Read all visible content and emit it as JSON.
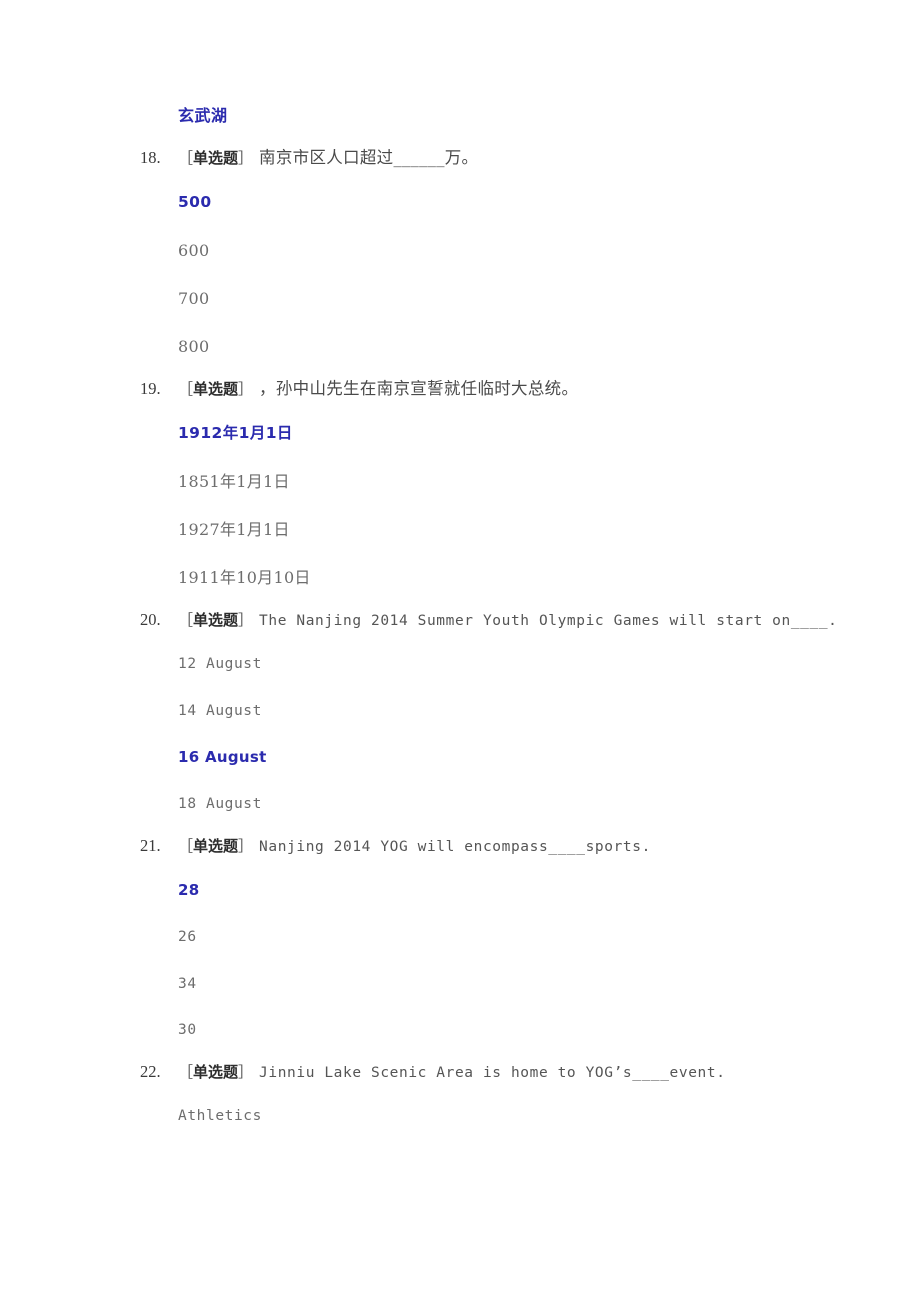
{
  "page": {
    "background": "#ffffff",
    "selected_color": "#2b2bae",
    "text_color": "#4a4a4a",
    "option_color": "#6d6d6d"
  },
  "orphan_option": {
    "label": "玄武湖",
    "selected": true
  },
  "questions": [
    {
      "number": "18.",
      "type_label": "［单选题］",
      "type_label_open": "［",
      "type_label_text": "单选题",
      "type_label_close": "］",
      "script": "cn",
      "text": "南京市区人口超过______万。",
      "options": [
        {
          "label": "500",
          "selected": true
        },
        {
          "label": "600",
          "selected": false
        },
        {
          "label": "700",
          "selected": false
        },
        {
          "label": "800",
          "selected": false
        }
      ]
    },
    {
      "number": "19.",
      "type_label": "［单选题］",
      "type_label_open": "［",
      "type_label_text": "单选题",
      "type_label_close": "］",
      "script": "cn",
      "text": "，孙中山先生在南京宣誓就任临时大总统。",
      "options": [
        {
          "label": "1912年1月1日",
          "selected": true
        },
        {
          "label": "1851年1月1日",
          "selected": false
        },
        {
          "label": "1927年1月1日",
          "selected": false
        },
        {
          "label": "1911年10月10日",
          "selected": false
        }
      ]
    },
    {
      "number": "20.",
      "type_label": "［单选题］",
      "type_label_open": "［",
      "type_label_text": "单选题",
      "type_label_close": "］",
      "script": "en",
      "text": "The Nanjing 2014 Summer Youth Olympic Games will start on____.",
      "options": [
        {
          "label": "12 August",
          "selected": false
        },
        {
          "label": "14 August",
          "selected": false
        },
        {
          "label": "16 August",
          "selected": true
        },
        {
          "label": "18 August",
          "selected": false
        }
      ]
    },
    {
      "number": "21.",
      "type_label": "［单选题］",
      "type_label_open": "［",
      "type_label_text": "单选题",
      "type_label_close": "］",
      "script": "en",
      "text": "Nanjing 2014 YOG will encompass____sports.",
      "options": [
        {
          "label": "28",
          "selected": true
        },
        {
          "label": "26",
          "selected": false
        },
        {
          "label": "34",
          "selected": false
        },
        {
          "label": "30",
          "selected": false
        }
      ]
    },
    {
      "number": "22.",
      "type_label": "［单选题］",
      "type_label_open": "［",
      "type_label_text": "单选题",
      "type_label_close": "］",
      "script": "en",
      "text": "Jinniu Lake Scenic Area is home to YOG’s____event.",
      "options": [
        {
          "label": "Athletics",
          "selected": false
        }
      ]
    }
  ]
}
